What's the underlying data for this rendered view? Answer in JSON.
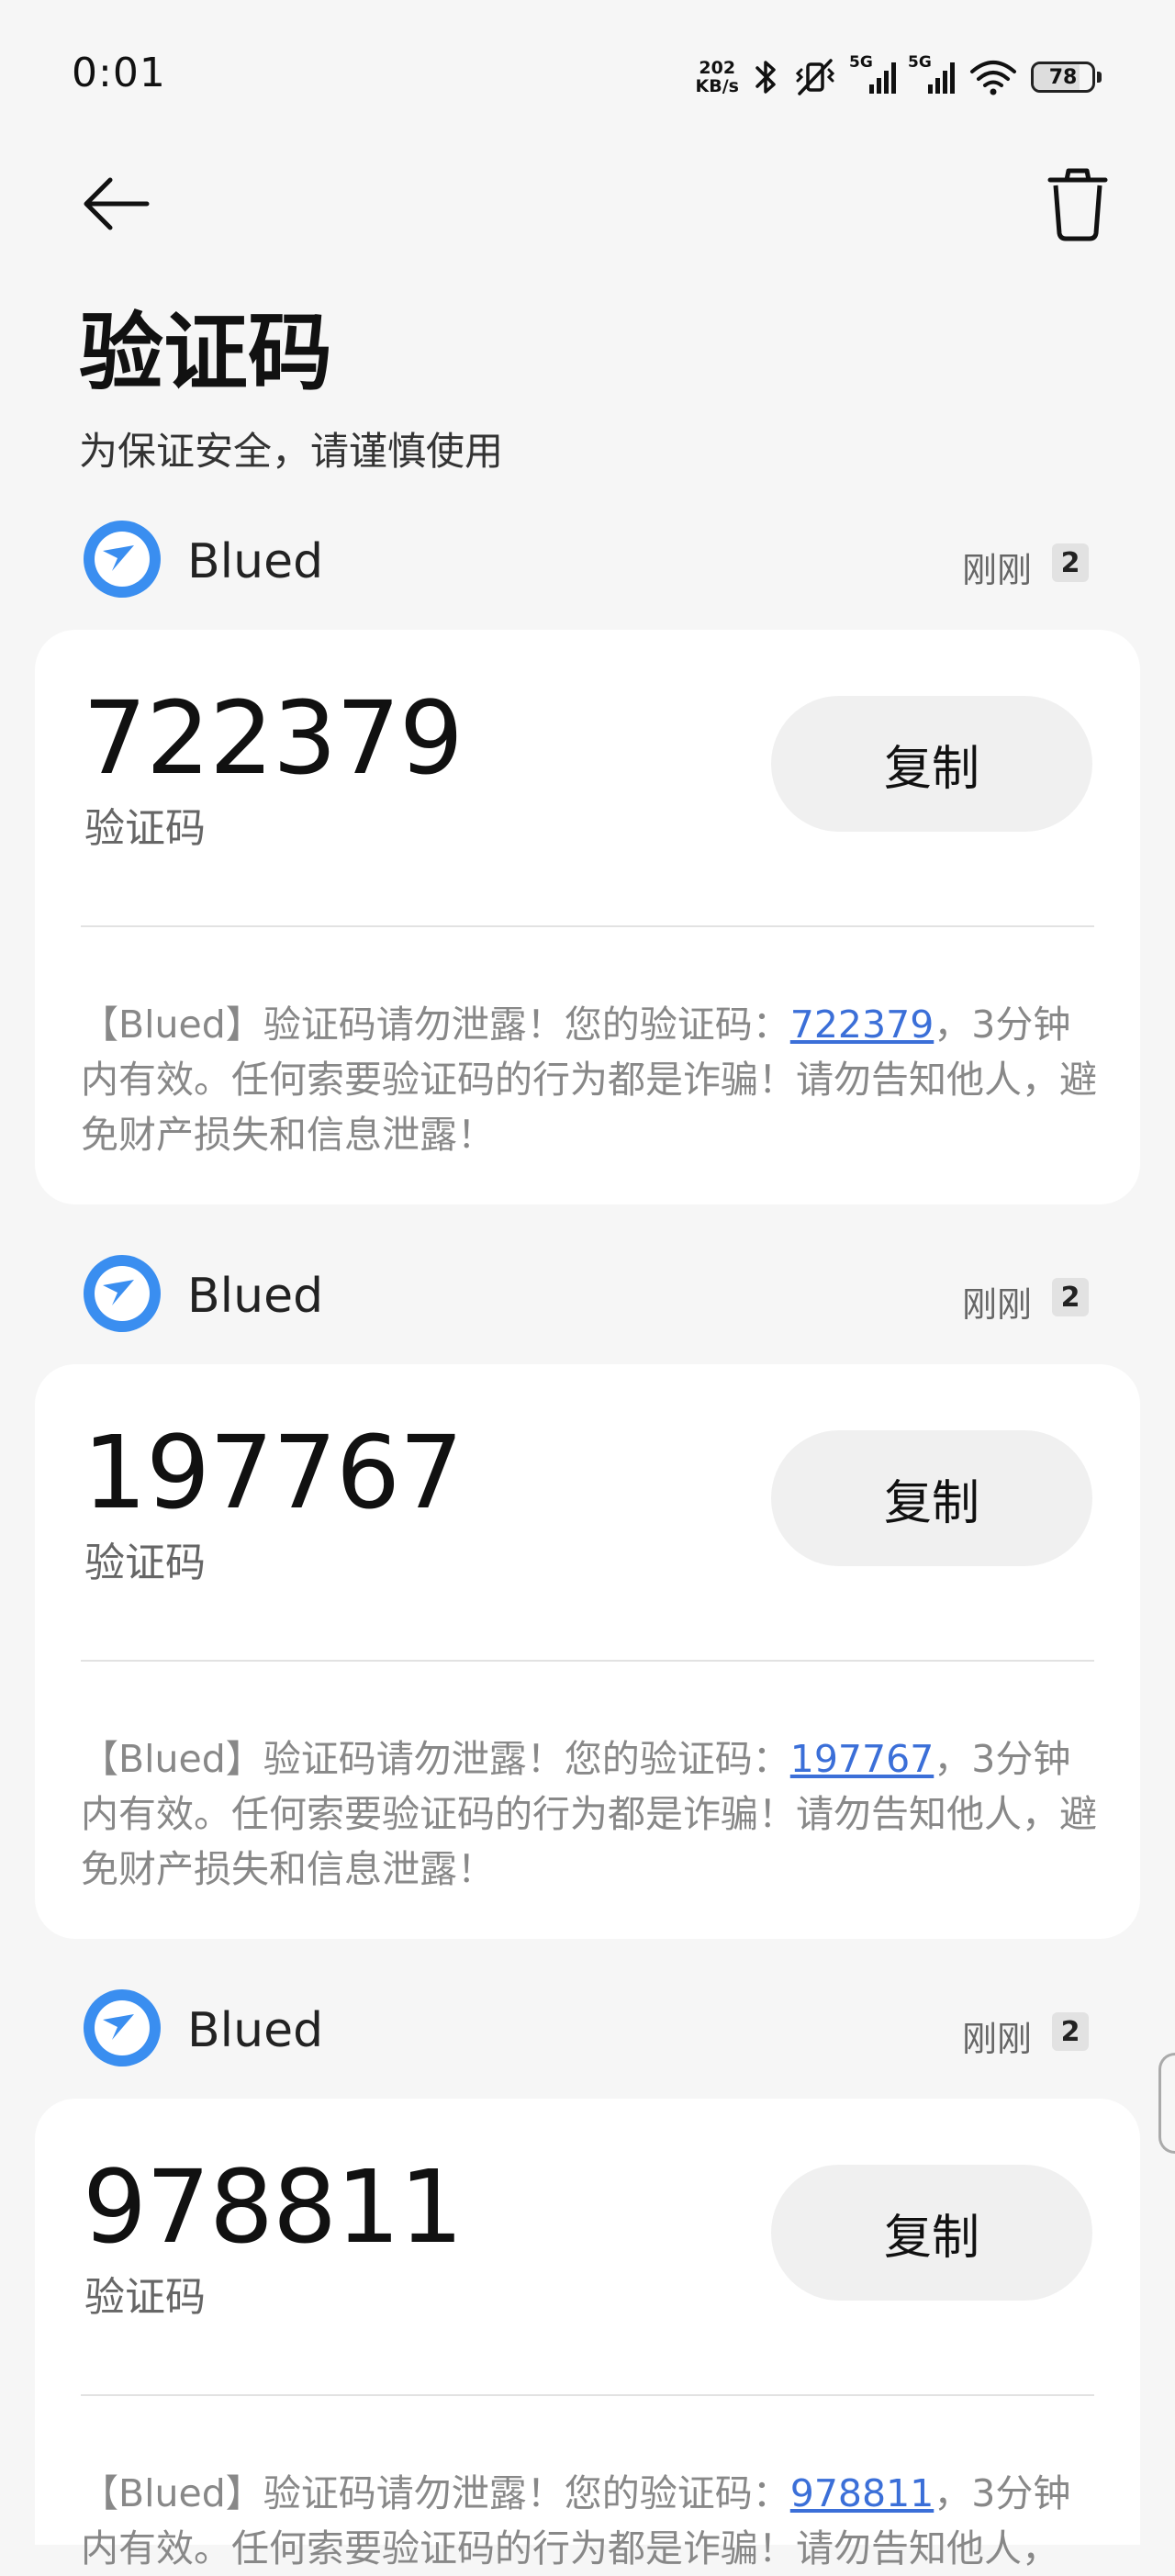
{
  "status_bar": {
    "time": "0:01",
    "net_speed_value": "202",
    "net_speed_unit": "KB/s",
    "signal_1_label": "5G",
    "signal_2_label": "5G",
    "battery_level": "78",
    "battery_fraction": 0.78,
    "icons": [
      "bluetooth-icon",
      "mute-vibrate-icon",
      "signal-icon",
      "signal-icon",
      "wifi-icon",
      "battery-icon"
    ]
  },
  "toolbar": {
    "back_icon": "back-arrow-icon",
    "delete_icon": "trash-icon"
  },
  "header": {
    "title": "验证码",
    "subtitle": "为保证安全，请谨慎使用"
  },
  "messages": [
    {
      "sender": "Blued",
      "time": "刚刚",
      "count": "2",
      "code": "722379",
      "code_label": "验证码",
      "copy_label": "复制",
      "text_before": "【Blued】验证码请勿泄露！您的验证码：",
      "text_link": "722379",
      "text_after": "，3分钟内有效。任何索要验证码的行为都是诈骗！请勿告知他人，避免财产损失和信息泄露！"
    },
    {
      "sender": "Blued",
      "time": "刚刚",
      "count": "2",
      "code": "197767",
      "code_label": "验证码",
      "copy_label": "复制",
      "text_before": "【Blued】验证码请勿泄露！您的验证码：",
      "text_link": "197767",
      "text_after": "，3分钟内有效。任何索要验证码的行为都是诈骗！请勿告知他人，避免财产损失和信息泄露！"
    },
    {
      "sender": "Blued",
      "time": "刚刚",
      "count": "2",
      "code": "978811",
      "code_label": "验证码",
      "copy_label": "复制",
      "text_before": "【Blued】验证码请勿泄露！您的验证码：",
      "text_link": "978811",
      "text_after": "，3分钟内有效。任何索要验证码的行为都是诈骗！请勿告知他人，"
    }
  ],
  "colors": {
    "background": "#f6f6f6",
    "card": "#ffffff",
    "link": "#3b6fd8",
    "copy_button": "#f0f0f0",
    "logo_blue": "#3a8ef0"
  }
}
